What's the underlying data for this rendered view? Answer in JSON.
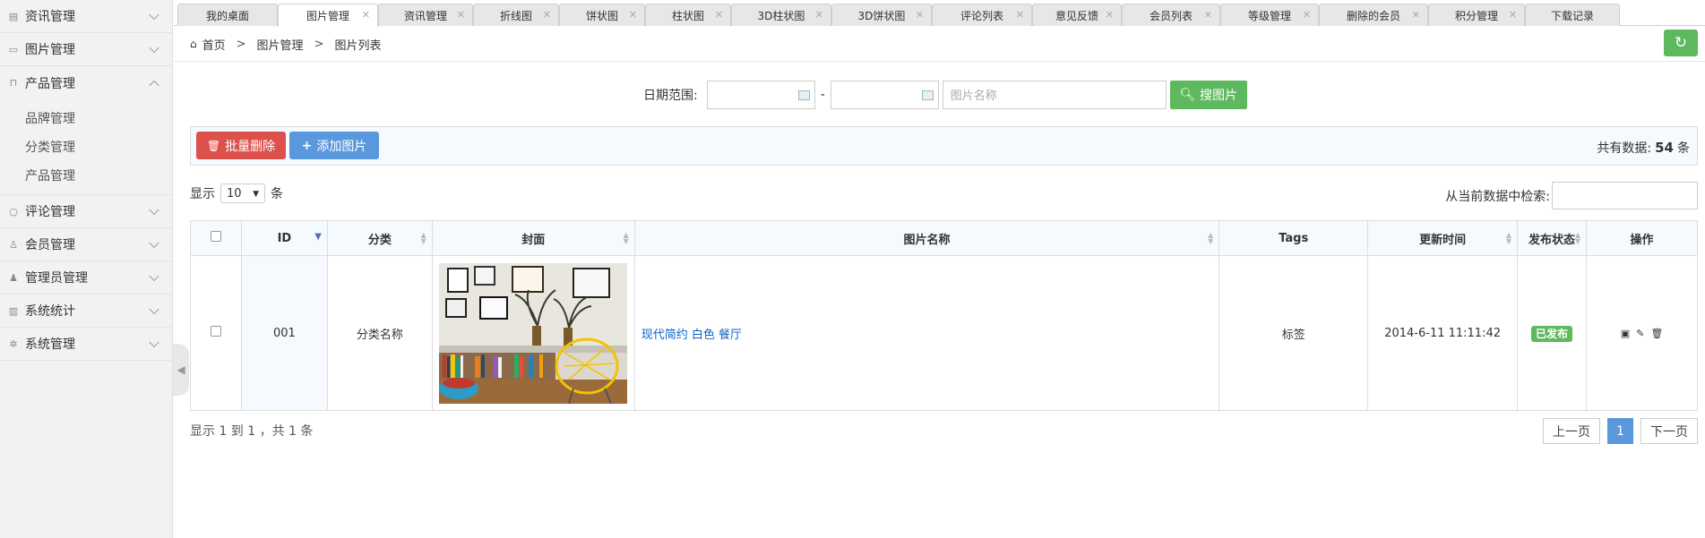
{
  "sidebar": {
    "items": [
      {
        "label": "资讯管理",
        "icon": "news-icon"
      },
      {
        "label": "图片管理",
        "icon": "picture-icon"
      },
      {
        "label": "产品管理",
        "icon": "bag-icon"
      },
      {
        "label": "评论管理",
        "icon": "comment-icon"
      },
      {
        "label": "会员管理",
        "icon": "user-icon"
      },
      {
        "label": "管理员管理",
        "icon": "admin-icon"
      },
      {
        "label": "系统统计",
        "icon": "chart-icon"
      },
      {
        "label": "系统管理",
        "icon": "gear-icon"
      }
    ],
    "sub_items": [
      "品牌管理",
      "分类管理",
      "产品管理"
    ]
  },
  "tabs": [
    "我的桌面",
    "图片管理",
    "资讯管理",
    "折线图",
    "饼状图",
    "柱状图",
    "3D柱状图",
    "3D饼状图",
    "评论列表",
    "意见反馈",
    "会员列表",
    "等级管理",
    "删除的会员",
    "积分管理",
    "下载记录"
  ],
  "breadcrumb": {
    "home": "首页",
    "sep": ">",
    "level1": "图片管理",
    "level2": "图片列表"
  },
  "search": {
    "date_label": "日期范围:",
    "dash": "-",
    "name_placeholder": "图片名称",
    "button": "搜图片"
  },
  "toolbar": {
    "batch_delete": "批量删除",
    "add_picture": "添加图片",
    "total_prefix": "共有数据:",
    "total_count": "54",
    "total_suffix": "条"
  },
  "length": {
    "prefix": "显示",
    "value": "10",
    "suffix": "条"
  },
  "filter": {
    "label": "从当前数据中检索:"
  },
  "table": {
    "headers": [
      "ID",
      "分类",
      "封面",
      "图片名称",
      "Tags",
      "更新时间",
      "发布状态",
      "操作"
    ],
    "rows": [
      {
        "id": "001",
        "category": "分类名称",
        "name": "现代简约 白色 餐厅",
        "tags": "标签",
        "updated": "2014-6-11 11:11:42",
        "status": "已发布"
      }
    ]
  },
  "footer": {
    "info": "显示 1 到 1 ，共 1 条",
    "prev": "上一页",
    "page": "1",
    "next": "下一页"
  },
  "colors": {
    "green": "#5eb95e",
    "red": "#dd514c",
    "blue": "#5a98de",
    "link": "#0e62c7"
  }
}
